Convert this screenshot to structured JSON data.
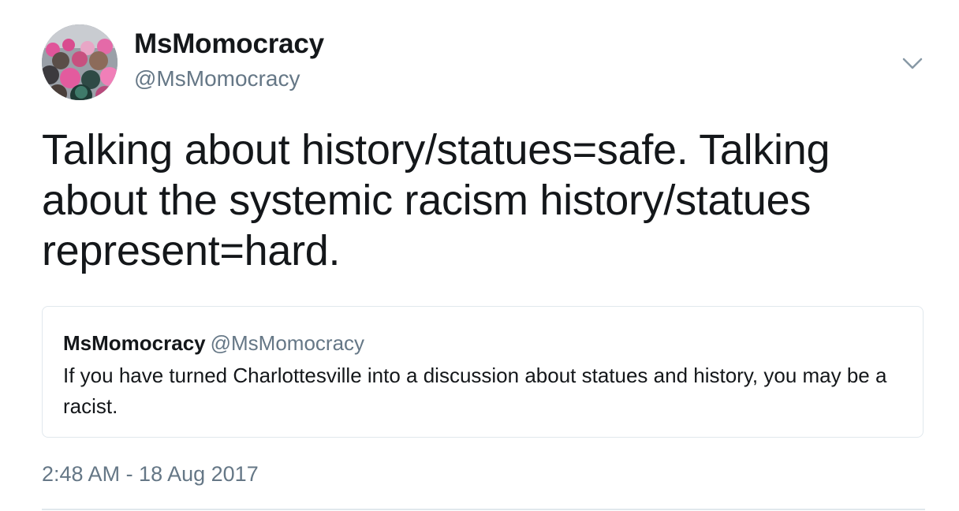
{
  "author": {
    "display_name": "MsMomocracy",
    "handle": "@MsMomocracy"
  },
  "menu": {
    "icon": "chevron-down-icon"
  },
  "tweet": {
    "text": "Talking about history/statues=safe. Talking about the systemic racism history/statues represent=hard."
  },
  "quoted_tweet": {
    "display_name": "MsMomocracy",
    "handle": "@MsMomocracy",
    "text": "If you have turned Charlottesville into a discussion about statues and history, you may be a racist."
  },
  "timestamp": "2:48 AM - 18 Aug 2017",
  "colors": {
    "text": "#14171a",
    "secondary": "#657786",
    "border": "#e1e8ed"
  }
}
